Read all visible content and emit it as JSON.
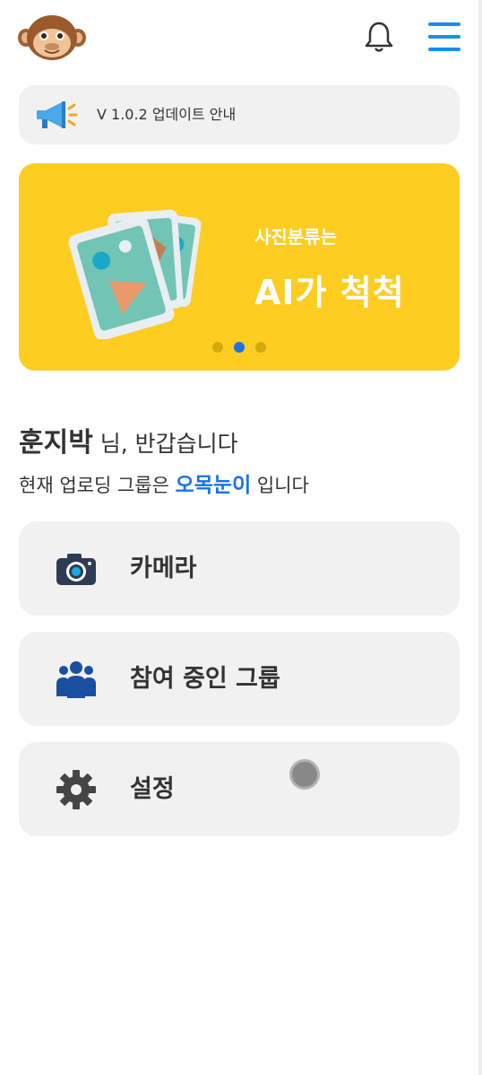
{
  "header": {
    "logo_icon": "monkey-logo-icon",
    "notification_icon": "bell-icon",
    "menu_icon": "hamburger-menu-icon"
  },
  "notice": {
    "icon": "megaphone-icon",
    "text": "V 1.0.2 업데이트 안내"
  },
  "banner": {
    "subtitle": "사진분류는",
    "title": "AI가 척척",
    "background_color": "#fdcd22",
    "slide_count": 3,
    "active_slide": 2
  },
  "greeting": {
    "name": "훈지박",
    "suffix": " 님, 반갑습니다",
    "group_prefix": "현재 업로딩 그룹은 ",
    "group_name": "오목눈이",
    "group_suffix": " 입니다"
  },
  "menu_items": [
    {
      "label": "카메라",
      "icon": "camera-icon"
    },
    {
      "label": "참여 중인 그룹",
      "icon": "group-icon"
    },
    {
      "label": "설정",
      "icon": "gear-icon"
    }
  ],
  "colors": {
    "accent": "#1a73e8",
    "card_bg": "#f1f1f1",
    "text": "#333333"
  }
}
